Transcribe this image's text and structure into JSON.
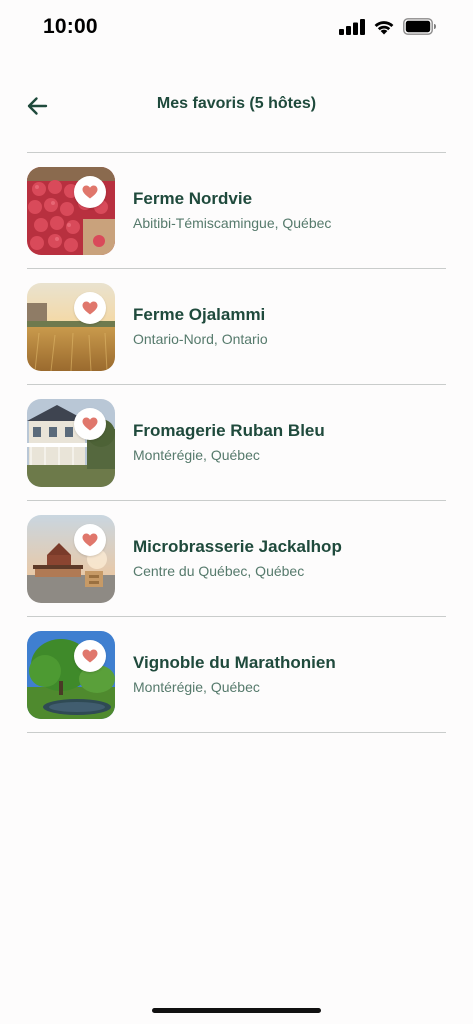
{
  "status_bar": {
    "time": "10:00"
  },
  "header": {
    "title": "Mes favoris (5 hôtes)"
  },
  "icons": {
    "back": "arrow-left-icon",
    "favorite": "heart-icon"
  },
  "colors": {
    "heading": "#1f4a3c",
    "subtitle": "#567a6c",
    "heart": "#e0776c",
    "divider": "#c9cccb"
  },
  "hosts": [
    {
      "name": "Ferme Nordvie",
      "location": "Abitibi-Témiscamingue, Québec"
    },
    {
      "name": "Ferme Ojalammi",
      "location": "Ontario-Nord, Ontario"
    },
    {
      "name": "Fromagerie Ruban Bleu",
      "location": "Montérégie, Québec"
    },
    {
      "name": "Microbrasserie Jackalhop",
      "location": "Centre du Québec, Québec"
    },
    {
      "name": "Vignoble du Marathonien",
      "location": "Montérégie, Québec"
    }
  ]
}
